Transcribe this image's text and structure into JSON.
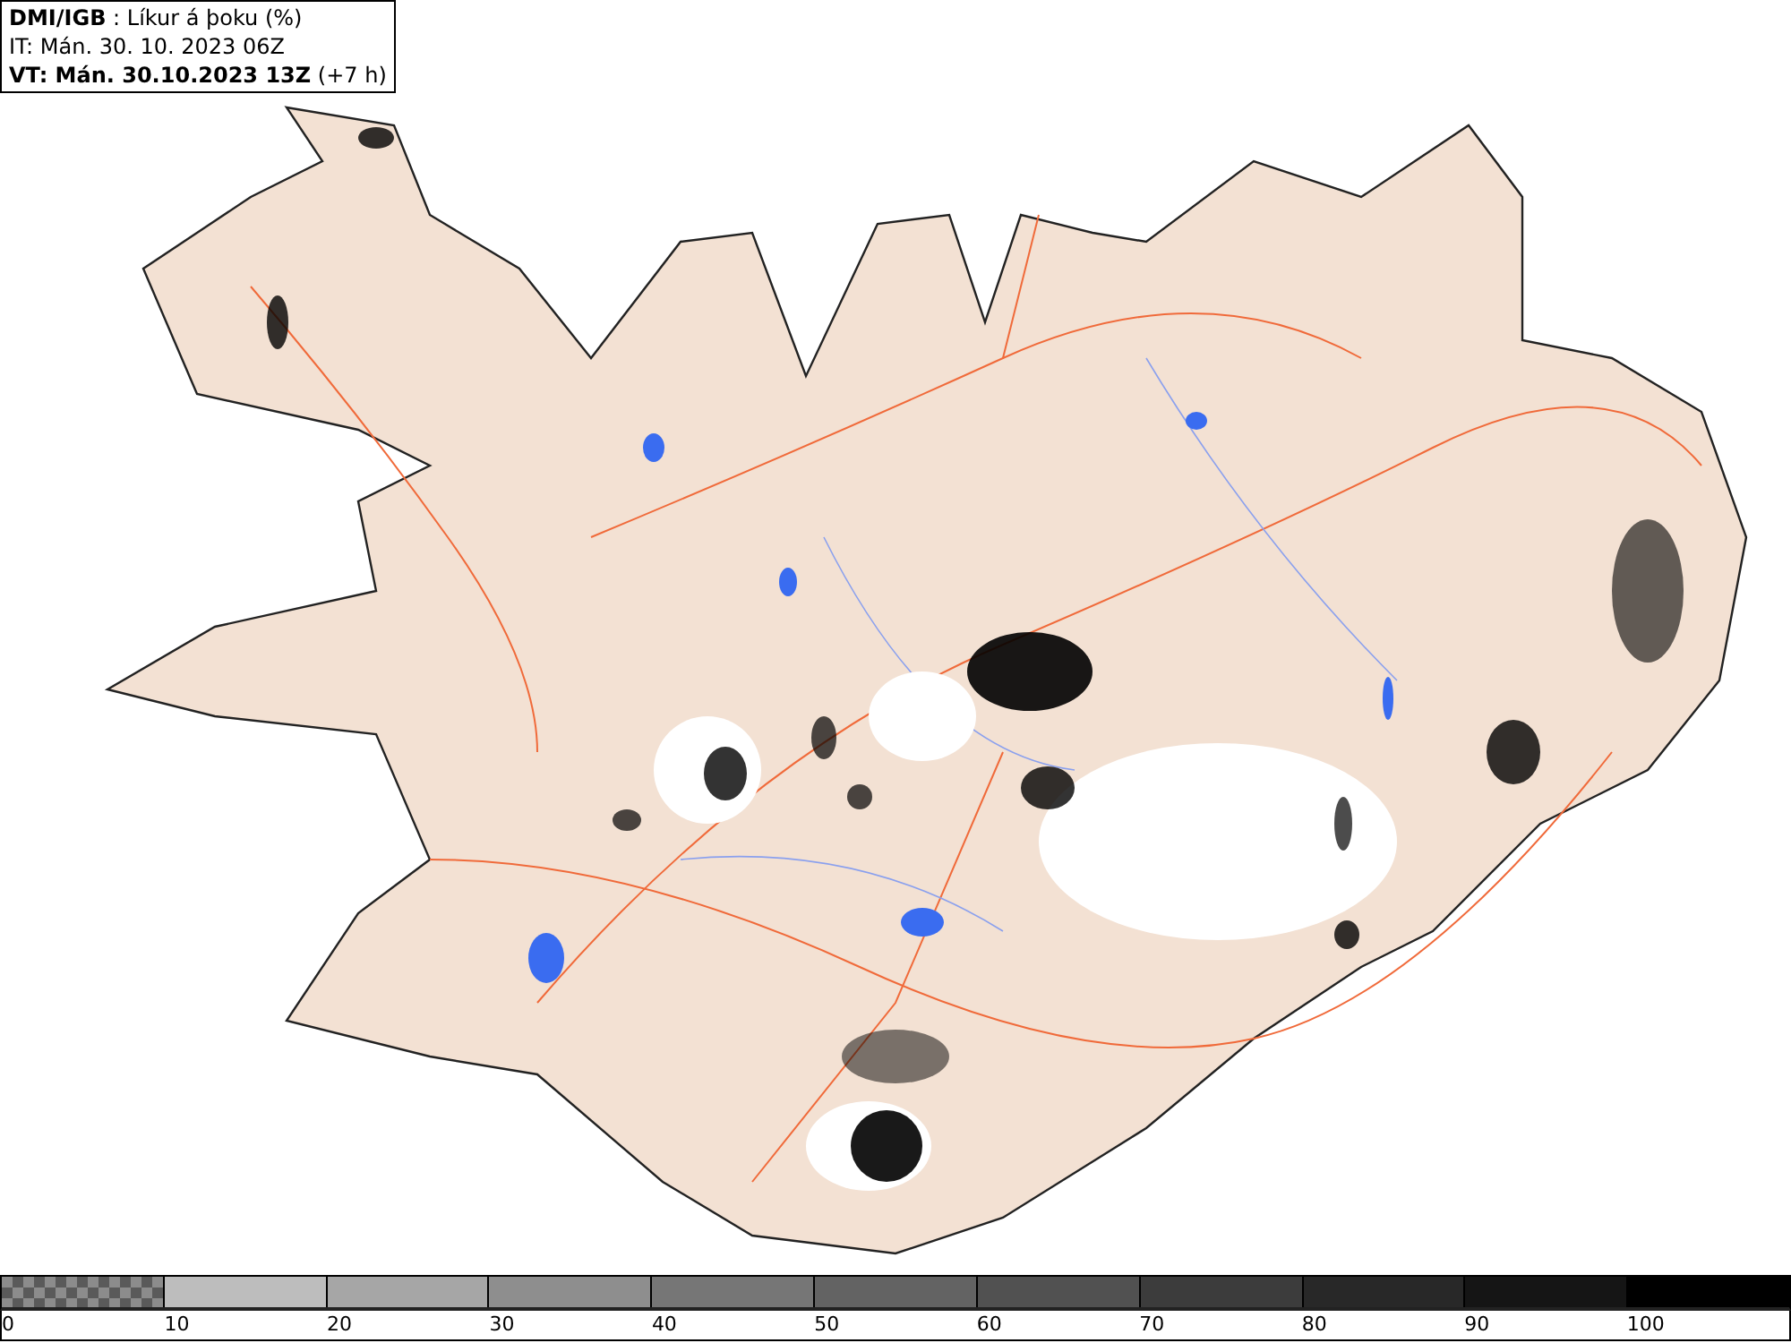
{
  "info_box": {
    "lines": [
      "**DMI/IGB** : Líkur á þoku (%)",
      "IT: Mán. 30. 10. 2023 06Z",
      "**VT: Mán. 30.10.2023 13Z** (+7 h)"
    ]
  },
  "legend": {
    "bins": [
      {
        "label": "0",
        "kind": "checker",
        "color": "#5a5a5a"
      },
      {
        "label": "10",
        "kind": "solid",
        "color": "#bdbdbd"
      },
      {
        "label": "20",
        "kind": "solid",
        "color": "#a6a6a6"
      },
      {
        "label": "30",
        "kind": "solid",
        "color": "#8e8e8e"
      },
      {
        "label": "40",
        "kind": "solid",
        "color": "#767676"
      },
      {
        "label": "50",
        "kind": "solid",
        "color": "#636363"
      },
      {
        "label": "60",
        "kind": "solid",
        "color": "#515151"
      },
      {
        "label": "70",
        "kind": "solid",
        "color": "#3c3c3c"
      },
      {
        "label": "80",
        "kind": "solid",
        "color": "#282828"
      },
      {
        "label": "90",
        "kind": "solid",
        "color": "#151515"
      },
      {
        "label": "100",
        "kind": "solid",
        "color": "#000000"
      }
    ]
  }
}
